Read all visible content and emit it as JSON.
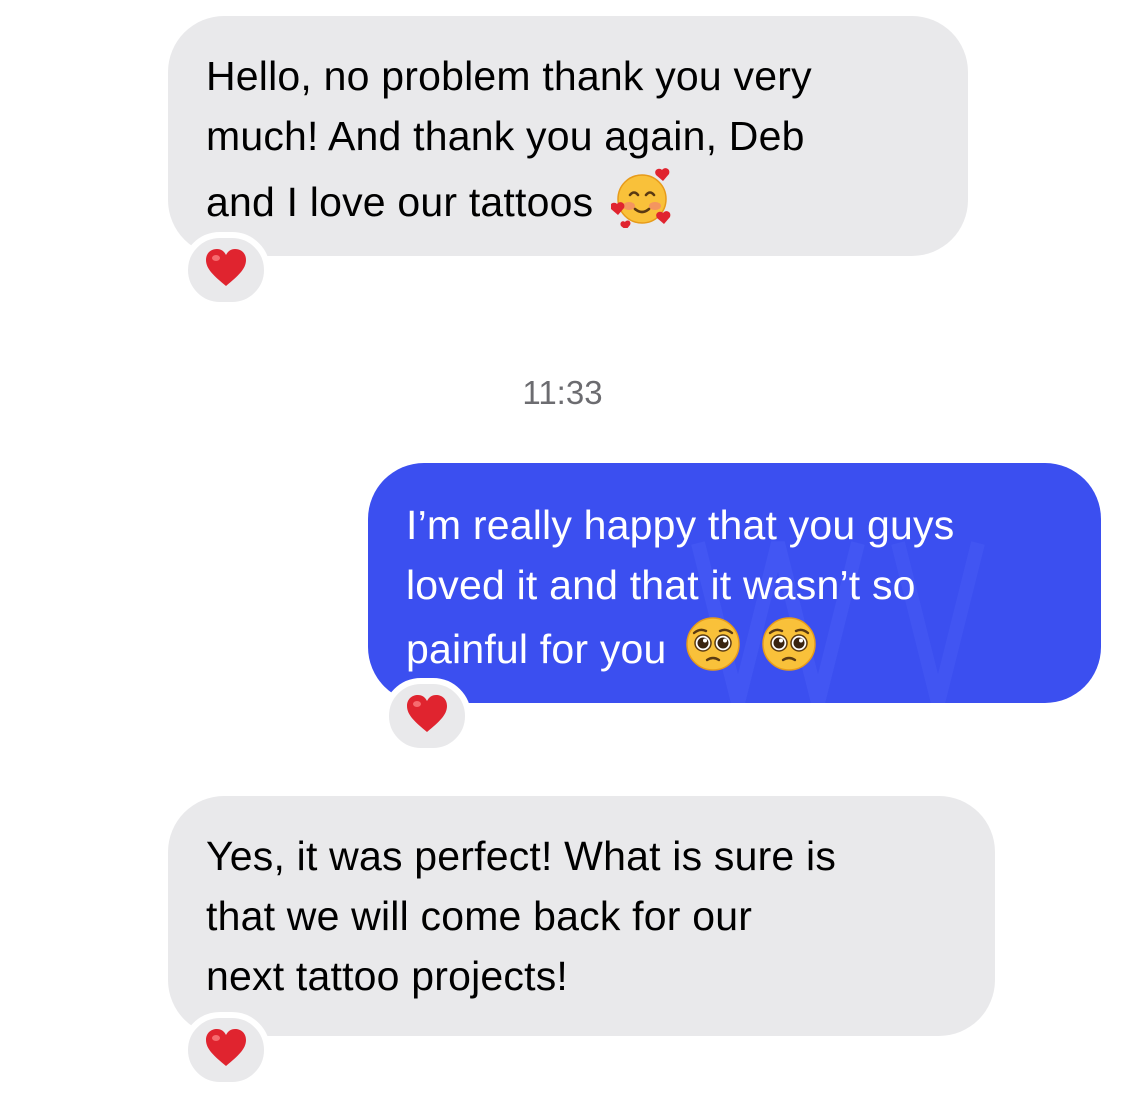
{
  "conversation": {
    "messages": [
      {
        "direction": "incoming",
        "lines": [
          "Hello, no problem thank you very",
          "much! And thank you again, Deb",
          "and I love our tattoos"
        ],
        "trailing_emoji": "smiling-face-with-hearts",
        "reaction": "red-heart"
      },
      {
        "direction": "outgoing",
        "lines": [
          "I’m really happy that you guys",
          "loved it and that it wasn’t so",
          "painful for you"
        ],
        "trailing_emoji": [
          "pleading-face",
          "pleading-face"
        ],
        "reaction": "red-heart"
      },
      {
        "direction": "incoming",
        "lines": [
          "Yes, it was perfect! What is sure is",
          "that we will come back for our",
          "next tattoo projects!"
        ],
        "reaction": "red-heart"
      }
    ],
    "timestamp": "11:33"
  },
  "colors": {
    "incoming_bubble": "#e9e9eb",
    "outgoing_bubble": "#3b4ff0",
    "timestamp_text": "#6c6c70",
    "heart": "#e0242f"
  }
}
